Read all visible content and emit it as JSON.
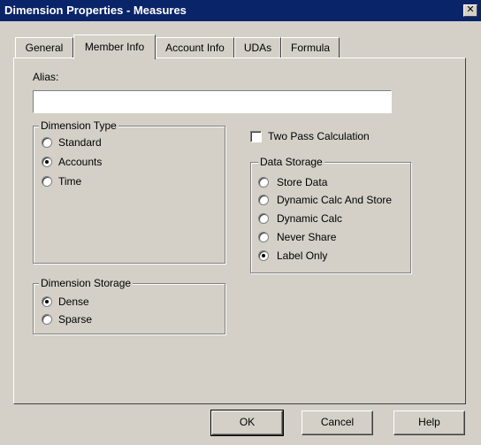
{
  "window": {
    "title": "Dimension Properties - Measures",
    "close_glyph": "✕"
  },
  "tabs": [
    {
      "label": "General",
      "active": false
    },
    {
      "label": "Member Info",
      "active": true
    },
    {
      "label": "Account Info",
      "active": false
    },
    {
      "label": "UDAs",
      "active": false
    },
    {
      "label": "Formula",
      "active": false
    }
  ],
  "alias": {
    "label": "Alias:",
    "value": ""
  },
  "dimension_type": {
    "legend": "Dimension Type",
    "options": [
      {
        "label": "Standard",
        "selected": false
      },
      {
        "label": "Accounts",
        "selected": true
      },
      {
        "label": "Time",
        "selected": false
      }
    ]
  },
  "two_pass": {
    "label": "Two Pass Calculation",
    "checked": false
  },
  "data_storage": {
    "legend": "Data Storage",
    "options": [
      {
        "label": "Store Data",
        "selected": false
      },
      {
        "label": "Dynamic Calc And Store",
        "selected": false
      },
      {
        "label": "Dynamic Calc",
        "selected": false
      },
      {
        "label": "Never Share",
        "selected": false
      },
      {
        "label": "Label Only",
        "selected": true
      }
    ]
  },
  "dimension_storage": {
    "legend": "Dimension Storage",
    "options": [
      {
        "label": "Dense",
        "selected": true
      },
      {
        "label": "Sparse",
        "selected": false
      }
    ]
  },
  "buttons": {
    "ok": "OK",
    "cancel": "Cancel",
    "help": "Help"
  }
}
